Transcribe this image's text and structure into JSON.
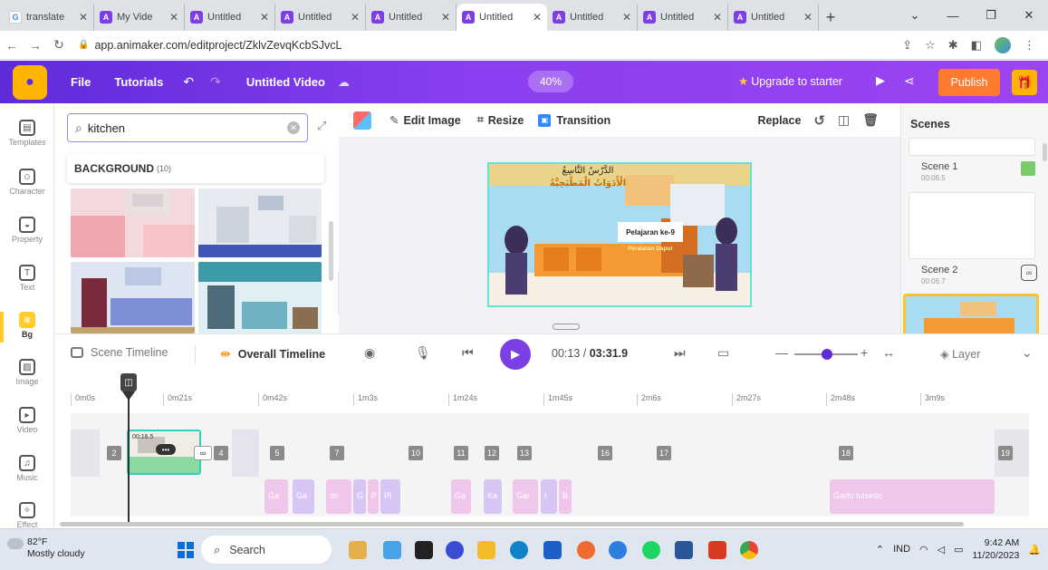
{
  "browser": {
    "tabs": [
      {
        "title": "translate",
        "icon": "google-icon",
        "active": false
      },
      {
        "title": "My Vide",
        "icon": "animaker-icon",
        "active": false
      },
      {
        "title": "Untitled",
        "icon": "animaker-icon",
        "active": false
      },
      {
        "title": "Untitled",
        "icon": "animaker-icon",
        "active": false
      },
      {
        "title": "Untitled",
        "icon": "animaker-icon",
        "active": false
      },
      {
        "title": "Untitled",
        "icon": "animaker-icon",
        "active": true
      },
      {
        "title": "Untitled",
        "icon": "animaker-icon",
        "active": false
      },
      {
        "title": "Untitled",
        "icon": "animaker-icon",
        "active": false
      },
      {
        "title": "Untitled",
        "icon": "animaker-icon",
        "active": false
      }
    ],
    "url": "app.animaker.com/editproject/ZklvZevqKcbSJvcL"
  },
  "appbar": {
    "file": "File",
    "tutorials": "Tutorials",
    "video_title": "Untitled Video",
    "zoom": "40%",
    "upgrade": "Upgrade to starter",
    "publish": "Publish",
    "brand_color": "#7b3fe4",
    "publish_color": "#ff7a2e"
  },
  "sidebar": {
    "items": [
      {
        "label": "Templates",
        "icon": "templates-icon"
      },
      {
        "label": "Character",
        "icon": "character-icon"
      },
      {
        "label": "Property",
        "icon": "property-icon"
      },
      {
        "label": "Text",
        "icon": "text-icon"
      },
      {
        "label": "Bg",
        "icon": "background-icon",
        "active": true
      },
      {
        "label": "Image",
        "icon": "image-icon"
      },
      {
        "label": "Video",
        "icon": "video-icon"
      },
      {
        "label": "Music",
        "icon": "music-icon"
      },
      {
        "label": "Effect",
        "icon": "effect-icon"
      }
    ]
  },
  "library": {
    "search_value": "kitchen",
    "category": "BACKGROUND",
    "category_count": "(10)"
  },
  "editor_toolbar": {
    "edit_image": "Edit Image",
    "resize": "Resize",
    "transition": "Transition",
    "replace": "Replace"
  },
  "canvas": {
    "arabic_title": "الدَّرْسُ التَّاسِعُ",
    "arabic_subtitle": "الْأَدَوَاتُ الْمَطْبَخِيَّةُ",
    "lesson": "Pelajaran ke-9",
    "topic": "Peralatan Dapur"
  },
  "scenes": {
    "header": "Scenes",
    "list": [
      {
        "name": "Scene 1",
        "duration": "00:06.5"
      },
      {
        "name": "Scene 2",
        "duration": "00:06.7"
      }
    ]
  },
  "timeline_bar": {
    "scene_timeline": "Scene Timeline",
    "overall_timeline": "Overall Timeline",
    "current_time": "00:13",
    "separator": " / ",
    "total_time": "03:31.9",
    "layer": "Layer"
  },
  "timeline": {
    "ruler": [
      "0m0s",
      "0m21s",
      "0m42s",
      "1m3s",
      "1m24s",
      "1m45s",
      "2m6s",
      "2m27s",
      "2m48s",
      "3m9s"
    ],
    "scene_boxes": [
      "2",
      "4",
      "5",
      "7",
      "10",
      "11",
      "12",
      "13",
      "16",
      "17",
      "18",
      "19"
    ],
    "selected_clip_duration": "00:16.5",
    "audio_clips": [
      {
        "label": "Ga"
      },
      {
        "label": "Ga"
      },
      {
        "label": "dri"
      },
      {
        "label": "G"
      },
      {
        "label": "P"
      },
      {
        "label": "Pi"
      },
      {
        "label": "Ga"
      },
      {
        "label": "Ka"
      },
      {
        "label": "Gar"
      },
      {
        "label": "I"
      },
      {
        "label": "B"
      },
      {
        "label": "Garfu tuisedo"
      }
    ]
  },
  "taskbar": {
    "temp": "82°F",
    "weather": "Mostly cloudy",
    "search": "Search",
    "lang": "IND",
    "time": "9:42 AM",
    "date": "11/20/2023"
  }
}
